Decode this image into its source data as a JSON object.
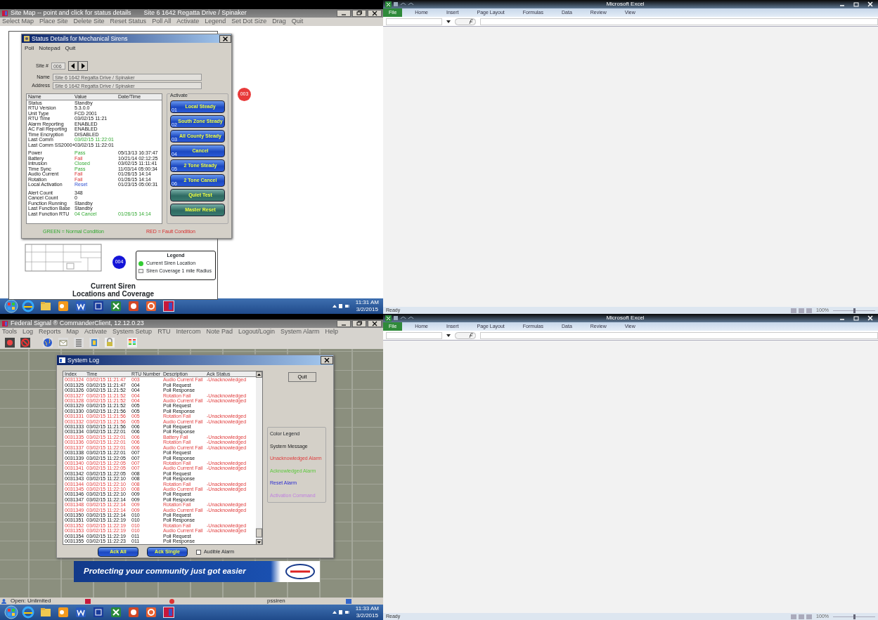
{
  "site_map": {
    "title": "Site Map -- point and click for status details",
    "subtitle": "Site 6 1642 Regatta Drive / Spinaker",
    "menu": [
      "Select Map",
      "Place Site",
      "Delete Site",
      "Reset Status",
      "Poll All",
      "Activate",
      "Legend",
      "Set Dot Size",
      "Drag",
      "Quit"
    ],
    "map": {
      "title_lines": [
        "Current Siren",
        "Locations and Coverage"
      ],
      "sites": [
        {
          "label": "003",
          "color": "#e83a3a"
        },
        {
          "label": "004",
          "color": "#1414d8"
        }
      ],
      "legend": {
        "title": "Legend",
        "items": [
          "Current Siren Location",
          "Siren Coverage 1 mile Radius"
        ]
      }
    },
    "status_dialog": {
      "title": "Status Details for Mechanical Sirens",
      "menu": [
        "Poll",
        "Notepad",
        "Quit"
      ],
      "site_label": "Site #",
      "site_value": "006",
      "name_label": "Name",
      "name_value": "Site 6 1642 Regatta Drive / Spinaker",
      "address_label": "Address",
      "address_value": "Site 6 1642 Regatta Drive / Spinaker",
      "columns": [
        "Name",
        "Value",
        "Date/Time"
      ],
      "groups": [
        [
          {
            "name": "Status",
            "value": "Standby",
            "kind": "plain"
          },
          {
            "name": "RTU Version",
            "value": "5.3.0.0",
            "kind": "plain"
          },
          {
            "name": "Unit Type",
            "value": "FCD 2001",
            "kind": "plain"
          },
          {
            "name": "RTU Time",
            "value": "03/02/15 11:21",
            "kind": "plain"
          },
          {
            "name": "Alarm Reporting",
            "value": "ENABLED",
            "kind": "plain"
          },
          {
            "name": "AC Fail Reporting",
            "value": "ENABLED",
            "kind": "plain"
          },
          {
            "name": "Time Encryption",
            "value": "DISABLED",
            "kind": "plain"
          },
          {
            "name": "Last Comm",
            "value": "03/02/15 11:22:01",
            "kind": "normal"
          },
          {
            "name": "Last Comm SS2000+",
            "value": "03/02/15 11:22:01",
            "kind": "plain"
          }
        ],
        [
          {
            "name": "Power",
            "value": "Pass",
            "time": "05/13/13 16:37:47",
            "kind": "normal"
          },
          {
            "name": "Battery",
            "value": "Fail",
            "time": "10/21/14 02:12:25",
            "kind": "fault"
          },
          {
            "name": "Intrusion",
            "value": "Closed",
            "time": "03/02/15 11:11:41",
            "kind": "normal"
          },
          {
            "name": "Time Sync",
            "value": "Pass",
            "time": "11/03/14 05:00:34",
            "kind": "normal"
          },
          {
            "name": "Audio Current",
            "value": "Fail",
            "time": "01/26/15 14:14",
            "kind": "fault"
          },
          {
            "name": "Rotation",
            "value": "Fail",
            "time": "01/26/15 14:14",
            "kind": "fault"
          },
          {
            "name": "Local Activation",
            "value": "Reset",
            "time": "01/23/15 05:00:31",
            "kind": "reset"
          }
        ],
        [
          {
            "name": "Alert Count",
            "value": "348",
            "kind": "plain"
          },
          {
            "name": "Cancel Count",
            "value": "0",
            "kind": "plain"
          },
          {
            "name": "Function Running",
            "value": "Standby",
            "kind": "plain"
          },
          {
            "name": "Last Function Base",
            "value": "Standby",
            "kind": "plain"
          },
          {
            "name": "Last Function RTU",
            "value": "04 Cancel",
            "time": "01/26/15 14:14",
            "kind": "normal",
            "time_normal": true
          }
        ]
      ],
      "legend_green": "GREEN = Normal Condition",
      "legend_red": "RED = Fault Condition",
      "activate_title": "Activate",
      "buttons": [
        {
          "label": "Local Steady",
          "code": "01",
          "kind": "activation"
        },
        {
          "label": "South Zone Steady",
          "code": "02",
          "kind": "activation"
        },
        {
          "label": "All County Steady",
          "code": "03",
          "kind": "activation"
        },
        {
          "label": "Cancel",
          "code": "04",
          "kind": "activation"
        },
        {
          "label": "2 Tone Steady",
          "code": "05",
          "kind": "activation"
        },
        {
          "label": "2 Tone Cancel",
          "code": "06",
          "kind": "activation"
        },
        {
          "label": "Quiet Test",
          "kind": "utility"
        },
        {
          "label": "Master Reset",
          "kind": "utility"
        }
      ]
    }
  },
  "taskbar_top": {
    "time": "11:31 AM",
    "date": "3/2/2015"
  },
  "commander": {
    "title": "Federal Signal ® CommanderClient, 12.12.0.23",
    "menu": [
      "Tools",
      "Log",
      "Reports",
      "Map",
      "Activate",
      "System Setup",
      "RTU",
      "Intercom",
      "Note Pad",
      "Logout/Login",
      "System Alarm",
      "Help"
    ],
    "banner": "Protecting your community just got easier",
    "system_log": {
      "title": "System Log",
      "quit": "Quit",
      "columns": [
        "Index",
        "Time",
        "RTU Number",
        "Description",
        "Ack Status"
      ],
      "rows": [
        {
          "index": "0031324",
          "time": "03/02/15 11:21:47",
          "rtu": "003",
          "description": "Audio Current Fail",
          "ack": "-Unacknowledged",
          "kind": "alarm"
        },
        {
          "index": "0031325",
          "time": "03/02/15 11:21:47",
          "rtu": "004",
          "description": "Poll Request",
          "kind": "system"
        },
        {
          "index": "0031326",
          "time": "03/02/15 11:21:52",
          "rtu": "004",
          "description": "Poll Response",
          "kind": "system"
        },
        {
          "index": "0031327",
          "time": "03/02/15 11:21:52",
          "rtu": "004",
          "description": "Rotation Fail",
          "ack": "-Unacknowledged",
          "kind": "alarm"
        },
        {
          "index": "0031328",
          "time": "03/02/15 11:21:52",
          "rtu": "004",
          "description": "Audio Current Fail",
          "ack": "-Unacknowledged",
          "kind": "alarm"
        },
        {
          "index": "0031329",
          "time": "03/02/15 11:21:52",
          "rtu": "005",
          "description": "Poll Request",
          "kind": "system"
        },
        {
          "index": "0031330",
          "time": "03/02/15 11:21:56",
          "rtu": "005",
          "description": "Poll Response",
          "kind": "system"
        },
        {
          "index": "0031331",
          "time": "03/02/15 11:21:56",
          "rtu": "005",
          "description": "Rotation Fail",
          "ack": "-Unacknowledged",
          "kind": "alarm"
        },
        {
          "index": "0031332",
          "time": "03/02/15 11:21:56",
          "rtu": "005",
          "description": "Audio Current Fail",
          "ack": "-Unacknowledged",
          "kind": "alarm"
        },
        {
          "index": "0031333",
          "time": "03/02/15 11:21:56",
          "rtu": "006",
          "description": "Poll Request",
          "kind": "system"
        },
        {
          "index": "0031334",
          "time": "03/02/15 11:22:01",
          "rtu": "006",
          "description": "Poll Response",
          "kind": "system"
        },
        {
          "index": "0031335",
          "time": "03/02/15 11:22:01",
          "rtu": "006",
          "description": "Battery Fail",
          "ack": "-Unacknowledged",
          "kind": "alarm"
        },
        {
          "index": "0031336",
          "time": "03/02/15 11:22:01",
          "rtu": "006",
          "description": "Rotation Fail",
          "ack": "-Unacknowledged",
          "kind": "alarm"
        },
        {
          "index": "0031337",
          "time": "03/02/15 11:22:01",
          "rtu": "006",
          "description": "Audio Current Fail",
          "ack": "-Unacknowledged",
          "kind": "alarm"
        },
        {
          "index": "0031338",
          "time": "03/02/15 11:22:01",
          "rtu": "007",
          "description": "Poll Request",
          "kind": "system"
        },
        {
          "index": "0031339",
          "time": "03/02/15 11:22:05",
          "rtu": "007",
          "description": "Poll Response",
          "kind": "system"
        },
        {
          "index": "0031340",
          "time": "03/02/15 11:22:05",
          "rtu": "007",
          "description": "Rotation Fail",
          "ack": "-Unacknowledged",
          "kind": "alarm"
        },
        {
          "index": "0031341",
          "time": "03/02/15 11:22:05",
          "rtu": "007",
          "description": "Audio Current Fail",
          "ack": "-Unacknowledged",
          "kind": "alarm"
        },
        {
          "index": "0031342",
          "time": "03/02/15 11:22:05",
          "rtu": "008",
          "description": "Poll Request",
          "kind": "system"
        },
        {
          "index": "0031343",
          "time": "03/02/15 11:22:10",
          "rtu": "008",
          "description": "Poll Response",
          "kind": "system"
        },
        {
          "index": "0031344",
          "time": "03/02/15 11:22:10",
          "rtu": "008",
          "description": "Rotation Fail",
          "ack": "-Unacknowledged",
          "kind": "alarm"
        },
        {
          "index": "0031345",
          "time": "03/02/15 11:22:10",
          "rtu": "008",
          "description": "Audio Current Fail",
          "ack": "-Unacknowledged",
          "kind": "alarm"
        },
        {
          "index": "0031346",
          "time": "03/02/15 11:22:10",
          "rtu": "009",
          "description": "Poll Request",
          "kind": "system"
        },
        {
          "index": "0031347",
          "time": "03/02/15 11:22:14",
          "rtu": "009",
          "description": "Poll Response",
          "kind": "system"
        },
        {
          "index": "0031348",
          "time": "03/02/15 11:22:14",
          "rtu": "009",
          "description": "Rotation Fail",
          "ack": "-Unacknowledged",
          "kind": "alarm"
        },
        {
          "index": "0031349",
          "time": "03/02/15 11:22:14",
          "rtu": "009",
          "description": "Audio Current Fail",
          "ack": "-Unacknowledged",
          "kind": "alarm"
        },
        {
          "index": "0031350",
          "time": "03/02/15 11:22:14",
          "rtu": "010",
          "description": "Poll Request",
          "kind": "system"
        },
        {
          "index": "0031351",
          "time": "03/02/15 11:22:19",
          "rtu": "010",
          "description": "Poll Response",
          "kind": "system"
        },
        {
          "index": "0031352",
          "time": "03/02/15 11:22:19",
          "rtu": "010",
          "description": "Rotation Fail",
          "ack": "-Unacknowledged",
          "kind": "alarm"
        },
        {
          "index": "0031353",
          "time": "03/02/15 11:22:19",
          "rtu": "010",
          "description": "Audio Current Fail",
          "ack": "-Unacknowledged",
          "kind": "alarm"
        },
        {
          "index": "0031354",
          "time": "03/02/15 11:22:19",
          "rtu": "011",
          "description": "Poll Request",
          "kind": "system"
        },
        {
          "index": "0031355",
          "time": "03/02/15 11:22:23",
          "rtu": "011",
          "description": "Poll Response",
          "kind": "system"
        }
      ],
      "color_legend_title": "Color Legend",
      "color_legend": [
        {
          "label": "System Message",
          "kind": "system"
        },
        {
          "label": "Unacknowledged Alarm",
          "kind": "unacknowledged"
        },
        {
          "label": "Acknowledged Alarm",
          "kind": "acknowledged"
        },
        {
          "label": "Reset Alarm",
          "kind": "reset"
        },
        {
          "label": "Activation Command",
          "kind": "activation"
        }
      ],
      "ack_all": "Ack All",
      "ack_single": "Ack Single",
      "audible_label": "Audible Alarm",
      "audible_checked": false
    },
    "status_left": "Open: Unlimited",
    "status_right": "pssiren"
  },
  "taskbar_bottom": {
    "time": "11:33 AM",
    "date": "3/2/2015"
  },
  "excel_windows": [
    {
      "title": "Microsoft Excel",
      "tabs": [
        {
          "label": "File",
          "selected": true
        },
        {
          "label": "Home",
          "selected": false
        },
        {
          "label": "Insert",
          "selected": false
        },
        {
          "label": "Page Layout",
          "selected": false
        },
        {
          "label": "Formulas",
          "selected": false
        },
        {
          "label": "Data",
          "selected": false
        },
        {
          "label": "Review",
          "selected": false
        },
        {
          "label": "View",
          "selected": false
        }
      ],
      "status": "Ready",
      "zoom": "100%",
      "zoom_slider": {
        "level": 0.5
      }
    },
    {
      "title": "Microsoft Excel",
      "tabs": [
        {
          "label": "File",
          "selected": true
        },
        {
          "label": "Home",
          "selected": false
        },
        {
          "label": "Insert",
          "selected": false
        },
        {
          "label": "Page Layout",
          "selected": false
        },
        {
          "label": "Formulas",
          "selected": false
        },
        {
          "label": "Data",
          "selected": false
        },
        {
          "label": "Review",
          "selected": false
        },
        {
          "label": "View",
          "selected": false
        }
      ],
      "status": "Ready",
      "zoom": "100%",
      "zoom_slider": {
        "level": 0.5
      }
    }
  ]
}
